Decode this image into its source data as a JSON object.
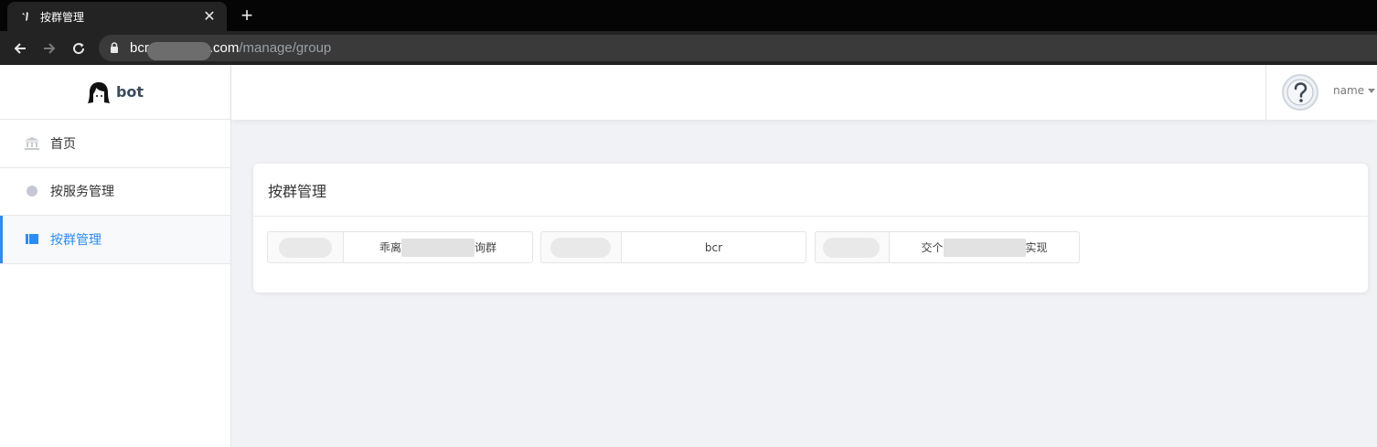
{
  "browser": {
    "tab_title": "按群管理",
    "url_host": "bcr",
    "url_tld": ".com",
    "url_path": "/manage/group"
  },
  "sidebar": {
    "brand": "bot",
    "items": [
      {
        "label": "首页",
        "icon": "bank-icon",
        "active": false
      },
      {
        "label": "按服务管理",
        "icon": "circle-icon",
        "active": false
      },
      {
        "label": "按群管理",
        "icon": "book-icon",
        "active": true
      }
    ]
  },
  "header": {
    "user_name": "name"
  },
  "card": {
    "title": "按群管理",
    "groups": [
      {
        "id": "",
        "name_prefix": "乖离",
        "name_suffix": "询群"
      },
      {
        "id": "",
        "name_prefix": "bcr",
        "name_suffix": ""
      },
      {
        "id": "",
        "name_prefix": "交个",
        "name_suffix": "实现"
      }
    ]
  },
  "colors": {
    "accent": "#2d8cf0",
    "background": "#f1f2f5"
  }
}
